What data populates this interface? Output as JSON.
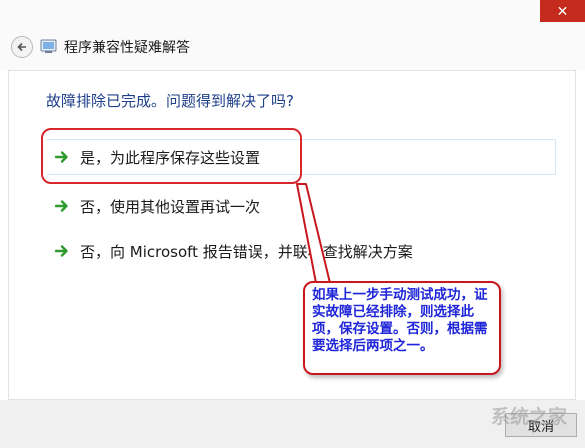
{
  "window": {
    "title": "程序兼容性疑难解答",
    "close_glyph": "✕"
  },
  "main": {
    "question": "故障排除已完成。问题得到解决了吗?",
    "options": [
      {
        "label": "是，为此程序保存这些设置",
        "icon": "green-arrow-icon"
      },
      {
        "label": "否，使用其他设置再试一次",
        "icon": "green-arrow-icon"
      },
      {
        "label": "否，向 Microsoft 报告错误，并联机查找解决方案",
        "icon": "green-arrow-icon"
      }
    ]
  },
  "annotation": {
    "text": "如果上一步手动测试成功，证实故障已经排除，则选择此项，保存设置。否则，根据需要选择后两项之一。",
    "border_color": "#c8181e",
    "text_color": "#1f25d9"
  },
  "footer": {
    "cancel_label": "取消",
    "watermark": "系统之家"
  },
  "colors": {
    "close_bg": "#c42b1c",
    "question": "#1e3f8a",
    "arrow": "#2e9b2e",
    "highlight": "#d8262a"
  }
}
